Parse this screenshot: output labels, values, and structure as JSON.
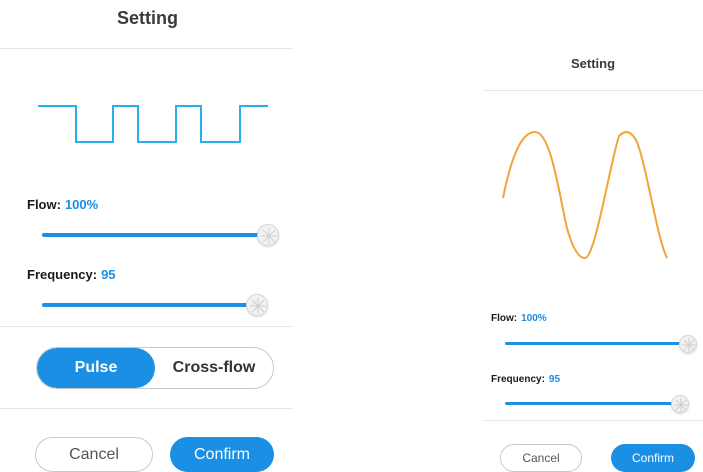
{
  "left_panel": {
    "title": "Setting",
    "waveform_icon": "square-wave",
    "flow": {
      "label": "Flow:",
      "value": "100%",
      "level": 100
    },
    "frequency": {
      "label": "Frequency:",
      "value": "95",
      "level": 95
    },
    "mode": {
      "options": [
        "Pulse",
        "Cross-flow"
      ],
      "selected": "Pulse"
    },
    "cancel_label": "Cancel",
    "confirm_label": "Confirm"
  },
  "right_panel": {
    "title": "Setting",
    "waveform_icon": "sine-wave",
    "flow": {
      "label": "Flow:",
      "value": "100%",
      "level": 100
    },
    "frequency": {
      "label": "Frequency:",
      "value": "95",
      "level": 95
    },
    "cancel_label": "Cancel",
    "confirm_label": "Confirm"
  },
  "colors": {
    "accent": "#1a8fe3",
    "square_wave": "#2ab0e8",
    "sine_wave": "#f0a43a"
  }
}
